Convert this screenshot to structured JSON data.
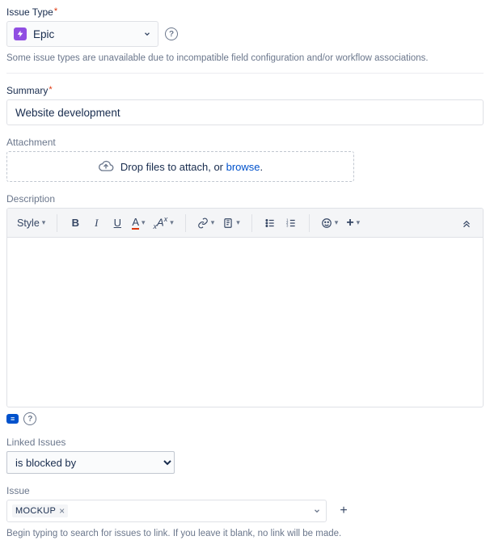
{
  "issueType": {
    "label": "Issue Type",
    "value": "Epic",
    "hint": "Some issue types are unavailable due to incompatible field configuration and/or workflow associations."
  },
  "summary": {
    "label": "Summary",
    "value": "Website development"
  },
  "attachment": {
    "label": "Attachment",
    "drop_text": "Drop files to attach, or ",
    "browse_text": "browse",
    "suffix": "."
  },
  "description": {
    "label": "Description",
    "style_label": "Style",
    "value": ""
  },
  "linked": {
    "label": "Linked Issues",
    "value": "is blocked by"
  },
  "issue": {
    "label": "Issue",
    "token": "MOCKUP",
    "hint": "Begin typing to search for issues to link. If you leave it blank, no link will be made."
  }
}
